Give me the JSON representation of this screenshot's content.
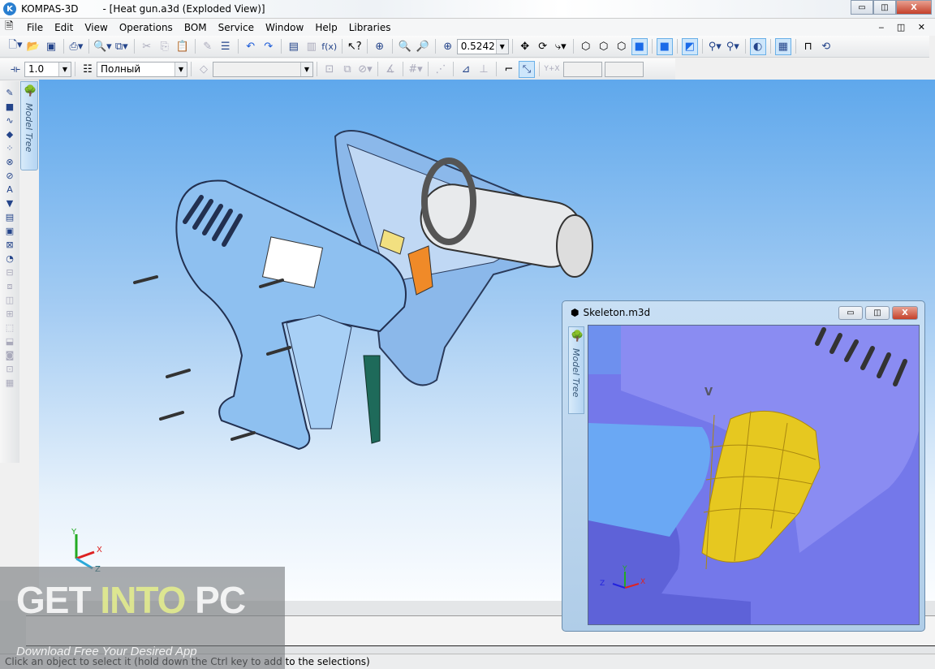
{
  "window": {
    "app_name": "KOMPAS-3D",
    "document_title": "- [Heat gun.a3d (Exploded View)]",
    "controls": {
      "minimize": "▭",
      "restore": "◫",
      "close": "X"
    }
  },
  "menu": {
    "items": [
      "File",
      "Edit",
      "View",
      "Operations",
      "BOM",
      "Service",
      "Window",
      "Help",
      "Libraries"
    ],
    "mdi_controls": "‒ ◫ ✕"
  },
  "toolbar_main": {
    "icons": [
      "new-document",
      "open-folder",
      "save",
      "print",
      "preview",
      "paste-special",
      "cut",
      "copy",
      "paste",
      "brush",
      "properties",
      "undo",
      "redo",
      "manager",
      "library",
      "variables",
      "help-pointer",
      "zoom-window",
      "zoom-in",
      "zoom-scale",
      "pan",
      "rotate",
      "orientation",
      "wireframe",
      "hidden-lines",
      "hidden-lines-thin",
      "shaded",
      "shaded-edges",
      "perspective",
      "light",
      "light-source",
      "section",
      "mass-properties",
      "measure",
      "rebuild"
    ],
    "zoom_value": "0.5242"
  },
  "toolbar_props": {
    "step_value": "1.0",
    "style_value": "Полный",
    "layer_value": ""
  },
  "left_toolbar": {
    "icons": [
      "edit-part",
      "extrude",
      "spline",
      "add-component",
      "array",
      "mate",
      "attach",
      "sketch",
      "filter",
      "spec",
      "surface",
      "diagnostics",
      "bend",
      "tool-1",
      "tool-2",
      "tool-3",
      "tool-4",
      "tool-5",
      "tool-6",
      "tool-7",
      "tool-8",
      "tool-9"
    ]
  },
  "model_tree_tab": "Model Tree",
  "axes": {
    "x": "X",
    "y": "Y",
    "z": "Z"
  },
  "child_window": {
    "title": "Skeleton.m3d",
    "model_tree_tab": "Model Tree",
    "point_label": "V",
    "axes": {
      "x": "X",
      "y": "Y",
      "z": "Z"
    }
  },
  "status": "Click an object to select it (hold down the Ctrl key to add to the selections)",
  "watermark": {
    "part1": "GET ",
    "part2": "INTO",
    "part3": " PC",
    "tagline": "Download Free Your Desired App"
  },
  "colors": {
    "viewport_top": "#5fa8ec",
    "model_blue": "#8ec0f0",
    "child_model": "#6f72e8",
    "highlight_yellow": "#e6c820",
    "trigger_orange": "#f08a28"
  }
}
